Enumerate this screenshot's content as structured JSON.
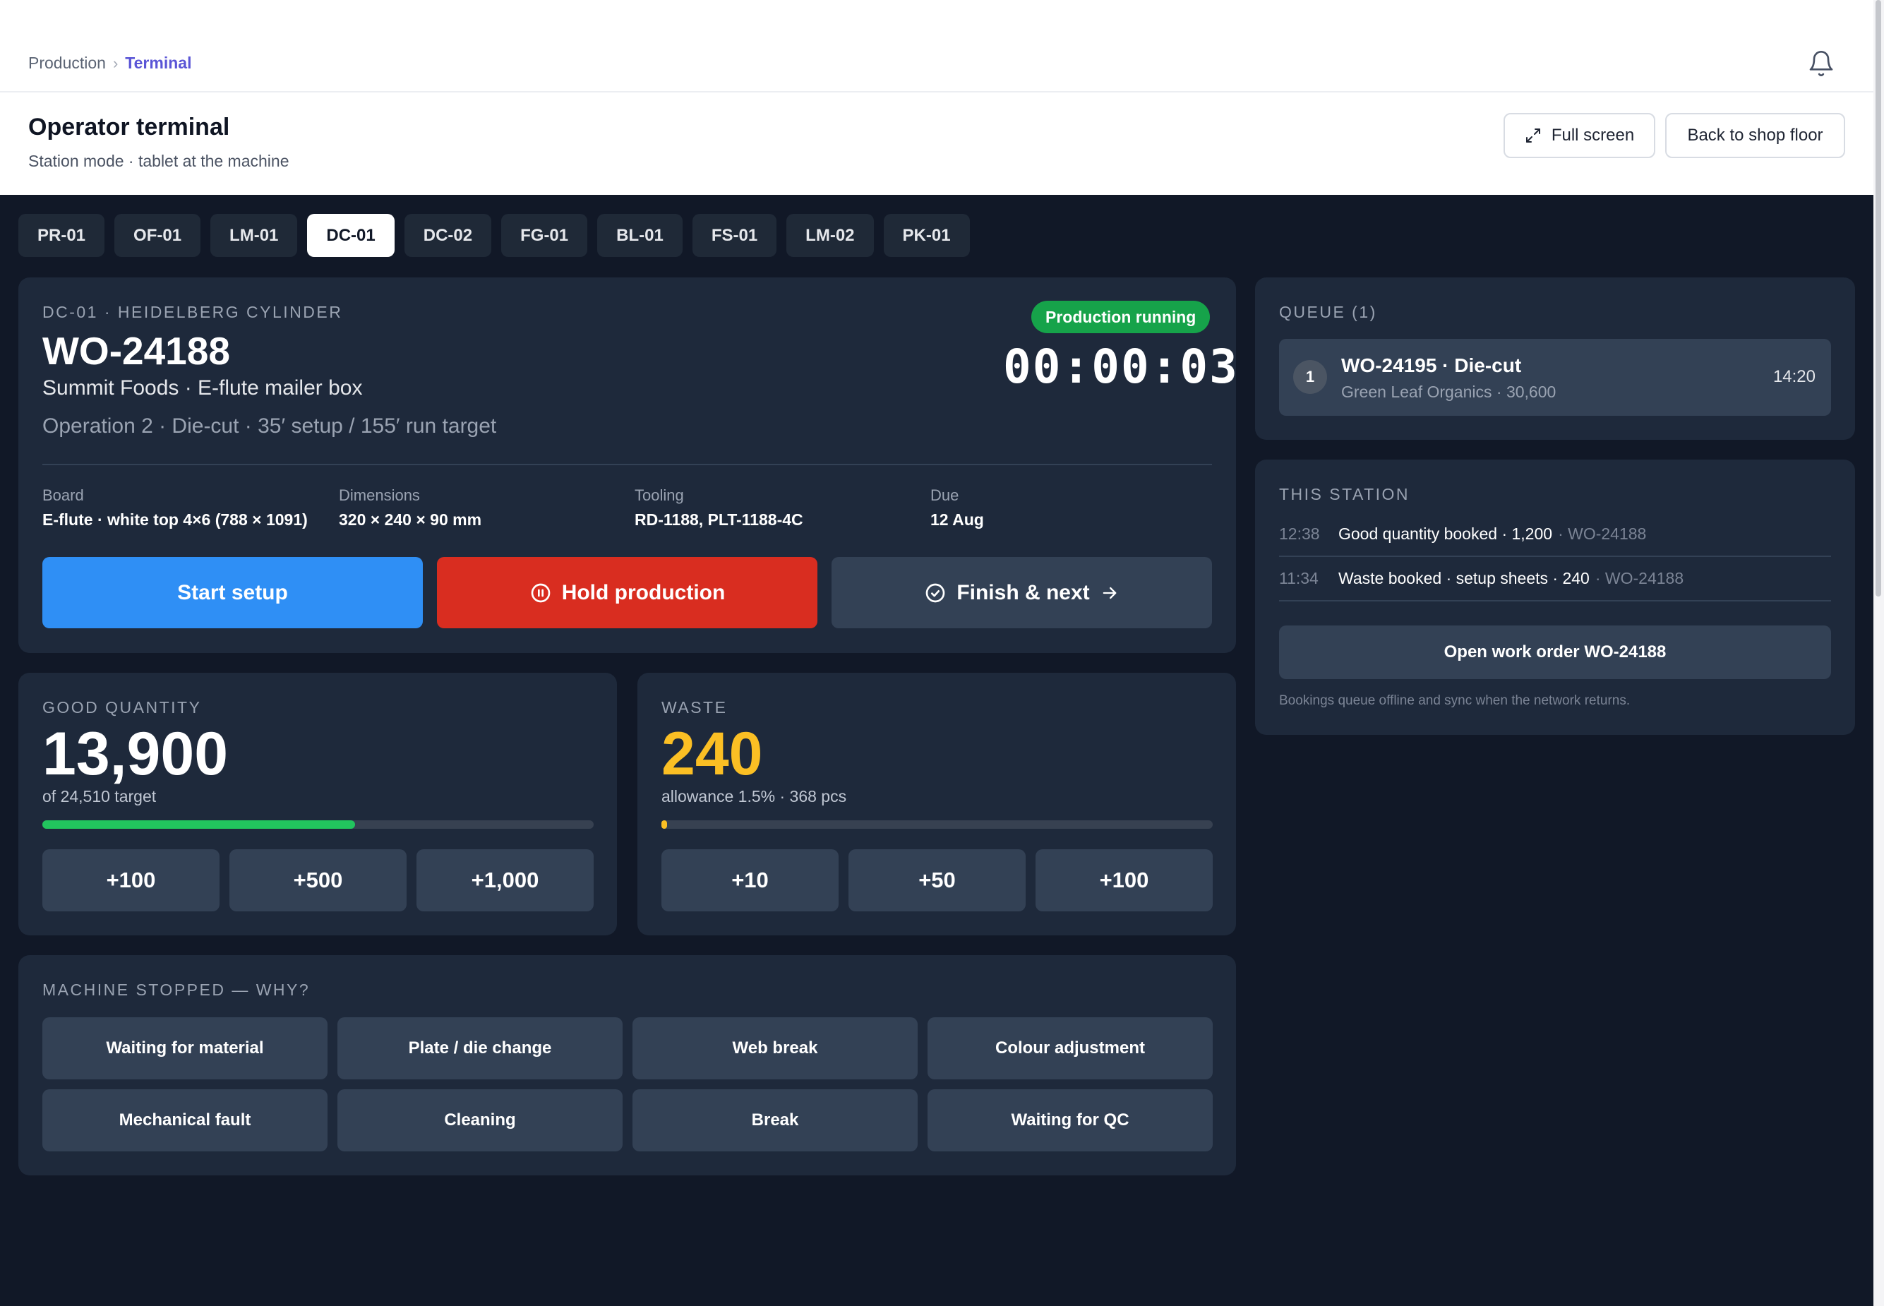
{
  "breadcrumb": {
    "parent": "Production",
    "separator": "›",
    "current": "Terminal"
  },
  "header": {
    "title": "Operator terminal",
    "subtitle": "Station mode · tablet at the machine",
    "fullscreen_label": "Full screen",
    "back_label": "Back to shop floor"
  },
  "stations": [
    "PR-01",
    "OF-01",
    "LM-01",
    "DC-01",
    "DC-02",
    "FG-01",
    "BL-01",
    "FS-01",
    "LM-02",
    "PK-01"
  ],
  "active_station": "DC-01",
  "job": {
    "machine": "DC-01 · Heidelberg Cylinder",
    "work_order": "WO-24188",
    "customer": "Summit Foods · E-flute mailer box",
    "operation": "Operation 2 · Die-cut · 35′ setup / 155′ run target",
    "status": "Production running",
    "timer": "00:00:03",
    "specs": [
      {
        "label": "Board",
        "value": "E-flute · white top 4×6 (788 × 1091)"
      },
      {
        "label": "Dimensions",
        "value": "320 × 240 × 90 mm"
      },
      {
        "label": "Tooling",
        "value": "RD-1188, PLT-1188-4C"
      },
      {
        "label": "Due",
        "value": "12 Aug"
      }
    ],
    "actions": {
      "start": "Start setup",
      "hold": "Hold production",
      "finish": "Finish & next"
    }
  },
  "good": {
    "label": "Good quantity",
    "value": "13,900",
    "target_text": "of 24,510 target",
    "progress": 0.567,
    "increments": [
      "+100",
      "+500",
      "+1,000"
    ]
  },
  "waste": {
    "label": "Waste",
    "value": "240",
    "allowance_text": "allowance 1.5% · 368 pcs",
    "progress": 0.007,
    "increments": [
      "+10",
      "+50",
      "+100"
    ]
  },
  "stop": {
    "label": "Machine stopped — why?",
    "reasons": [
      "Waiting for material",
      "Plate / die change",
      "Web break",
      "Colour adjustment",
      "Mechanical fault",
      "Cleaning",
      "Break",
      "Waiting for QC"
    ]
  },
  "queue": {
    "label": "Queue (1)",
    "items": [
      {
        "num": "1",
        "title": "WO-24195 · Die-cut",
        "sub": "Green Leaf Organics · 30,600",
        "time": "14:20"
      }
    ]
  },
  "station": {
    "label": "This station",
    "log": [
      {
        "time": "12:38",
        "text": "Good quantity booked · 1,200",
        "ref": "· WO-24188"
      },
      {
        "time": "11:34",
        "text": "Waste booked · setup sheets · 240",
        "ref": "· WO-24188"
      }
    ],
    "open_label": "Open work order WO-24188",
    "note": "Bookings queue offline and sync when the network returns."
  },
  "colors": {
    "accent": "#5a55d6",
    "running": "#16a34a",
    "start": "#2f8ff5",
    "hold": "#d92d20",
    "good_bar": "#22c55e",
    "waste_value": "#fbbf24"
  }
}
